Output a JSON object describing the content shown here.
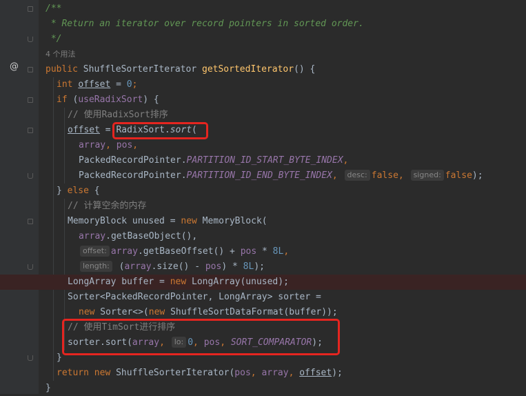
{
  "code": {
    "doc_open": "/**",
    "doc_text": " * Return an iterator over record pointers in sorted order.",
    "doc_close": " */",
    "usages": "4 个用法",
    "sig": {
      "kw_public": "public",
      "type": "ShuffleSorterIterator",
      "method": "getSortedIterator",
      "rest": "() {"
    },
    "l_offset_decl": {
      "kw": "int",
      "var": "offset",
      "eq": " = ",
      "num": "0",
      "end": ";"
    },
    "l_if": {
      "kw": "if",
      "open": " (",
      "cond": "useRadixSort",
      "close": ") {"
    },
    "c_radix": "// 使用RadixSort排序",
    "l_radix": {
      "var": "offset",
      "eq": " = ",
      "call": "RadixSort.",
      "method": "sort",
      "open": "("
    },
    "l_args1": {
      "array": "array",
      "sep": ", ",
      "pos": "pos",
      "end": ","
    },
    "l_args2": {
      "prefix": "PackedRecordPointer.",
      "field": "PARTITION_ID_START_BYTE_INDEX",
      "end": ","
    },
    "l_args3": {
      "prefix": "PackedRecordPointer.",
      "field": "PARTITION_ID_END_BYTE_INDEX",
      "sep": ", ",
      "hint_desc": "desc:",
      "false1": "false",
      "comma": ", ",
      "hint_signed": "signed:",
      "false2": "false",
      "end": ");"
    },
    "l_else": {
      "open": "} ",
      "kw": "else",
      "close": " {"
    },
    "c_mem": "// 计算空余的内存",
    "l_mem": {
      "type": "MemoryBlock unused = ",
      "kw": "new",
      "rest": " MemoryBlock("
    },
    "l_mem1": {
      "array": "array",
      "rest": ".getBaseObject(),"
    },
    "l_mem2": {
      "hint": "offset:",
      "array": "array",
      "mid": ".getBaseOffset() + ",
      "pos": "pos",
      "mul": " * ",
      "num": "8L",
      "end": ","
    },
    "l_mem3": {
      "hint": "length:",
      "open": " (",
      "array": "array",
      "mid": ".size() - ",
      "pos": "pos",
      "mul": ") * ",
      "num": "8L",
      "end": ");"
    },
    "l_buf": {
      "pre": "LongArray buffer = ",
      "kw": "new",
      "post": " LongArray(unused);"
    },
    "l_sorter": "Sorter<PackedRecordPointer, LongArray> sorter =",
    "l_sorter2": {
      "kw1": "new",
      "mid": " Sorter<>(",
      "kw2": "new",
      "post": " ShuffleSortDataFormat(buffer));"
    },
    "c_tim": "// 使用TimSort进行排序",
    "l_sort": {
      "pre": "sorter.sort(",
      "array": "array",
      "sep": ", ",
      "hint": "lo:",
      "num": "0",
      "sep2": ", ",
      "pos": "pos",
      "sep3": ", ",
      "cmp": "SORT_COMPARATOR",
      "end": ");"
    },
    "l_close": "}",
    "l_return": {
      "kw": "return",
      "sp": " ",
      "kw2": "new",
      "mid": " ShuffleSorterIterator(",
      "pos": "pos",
      "sep": ", ",
      "array": "array",
      "sep2": ", ",
      "offset": "offset",
      "end": ");"
    },
    "l_final": "}"
  },
  "gutter": {
    "override_marker": "@",
    "breakpoint_color": "#c75450"
  },
  "colors": {
    "keyword": "#cc7832",
    "method": "#ffc66d",
    "comment": "#808080",
    "doc": "#629755",
    "number": "#6897bb",
    "param": "#9876aa",
    "highlight": "#e52520"
  }
}
